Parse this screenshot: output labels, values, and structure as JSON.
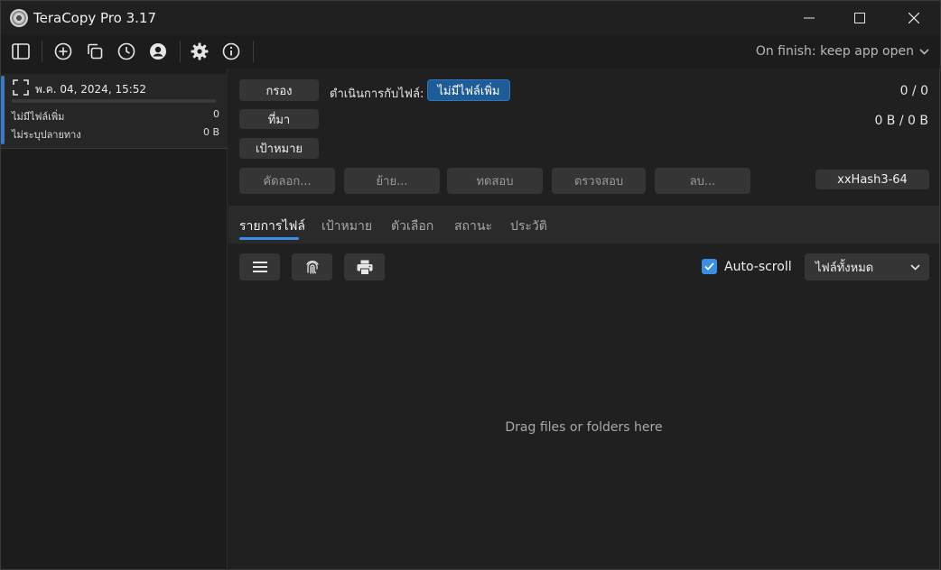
{
  "window": {
    "title": "TeraCopy Pro 3.17",
    "controls": [
      "minimize",
      "maximize",
      "close"
    ]
  },
  "toolbar": {
    "icons": [
      "sidebar-icon",
      "add-icon",
      "copy-icon",
      "history-icon",
      "account-icon",
      "settings-icon",
      "info-icon"
    ],
    "on_finish": "On finish: keep app open"
  },
  "sidebar": {
    "job": {
      "date": "พ.ค. 04, 2024, 15:52",
      "progress": 0,
      "rows": [
        {
          "label": "ไม่มีไฟล์เพิ่ม",
          "value": "0"
        },
        {
          "label": "ไม่ระบุปลายทาง",
          "value": "0 B"
        }
      ]
    }
  },
  "main": {
    "filter_button": "กรอง",
    "source_button": "ที่มา",
    "target_button": "เป้าหมาย",
    "file_action_label": "ดำเนินการกับไฟล์:",
    "file_action_value": "ไม่มีไฟล์เพิ่ม",
    "count": "0 / 0",
    "size": "0 B / 0 B",
    "actions": {
      "copy": "คัดลอก...",
      "move": "ย้าย...",
      "test": "ทดสอบ",
      "verify": "ตรวจสอบ",
      "delete": "ลบ..."
    },
    "hash": "xxHash3-64",
    "tabs": [
      "รายการไฟล์",
      "เป้าหมาย",
      "ตัวเลือก",
      "สถานะ",
      "ประวัติ"
    ],
    "active_tab": "รายการไฟล์",
    "list_tools": [
      "menu-icon",
      "fingerprint-icon",
      "print-icon"
    ],
    "autoscroll": {
      "label": "Auto-scroll",
      "checked": true
    },
    "filter_select": "ไฟล์ทั้งหมด",
    "dropzone": "Drag files or folders here"
  },
  "colors": {
    "accent": "#3a8ee6",
    "primary_button": "#1d5c96",
    "background": "#202020"
  }
}
